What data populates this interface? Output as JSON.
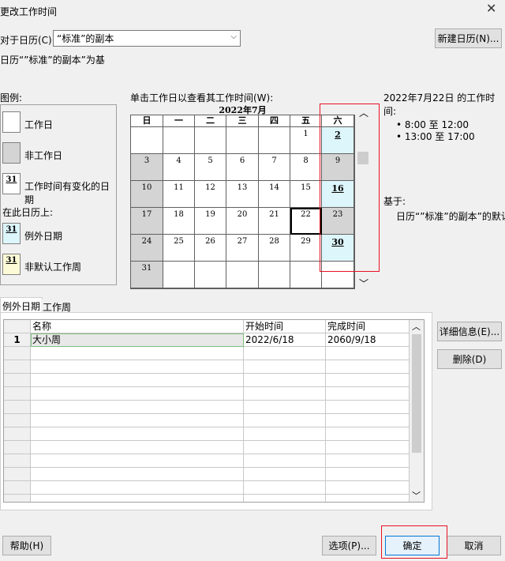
{
  "window": {
    "title": "更改工作时间",
    "close_glyph": "✕"
  },
  "calendar_select": {
    "label": "对于日历(C):",
    "value": "“标准”的副本",
    "base_text": "日历“”标准”的副本”为基"
  },
  "buttons": {
    "new_calendar": "新建日历(N)...",
    "details": "详细信息(E)...",
    "delete": "删除(D)",
    "help": "帮助(H)",
    "options": "选项(P)...",
    "ok": "确定",
    "cancel": "取消"
  },
  "legend": {
    "title": "图例:",
    "working_day": "工作日",
    "nonworking_day": "非工作日",
    "changed_day": "工作时间有变化的日期",
    "on_this_calendar": "在此日历上:",
    "exception_day": "例外日期",
    "nondefault_week": "非默认工作周",
    "swatch_num": "31"
  },
  "calendar_view": {
    "instruction": "单击工作日以查看其工作时间(W):",
    "month_title": "2022年7月",
    "weekdays": [
      "日",
      "一",
      "二",
      "三",
      "四",
      "五",
      "六"
    ],
    "weeks": [
      [
        "",
        "",
        "",
        "",
        "",
        "1",
        "2"
      ],
      [
        "3",
        "4",
        "5",
        "6",
        "7",
        "8",
        "9"
      ],
      [
        "10",
        "11",
        "12",
        "13",
        "14",
        "15",
        "16"
      ],
      [
        "17",
        "18",
        "19",
        "20",
        "21",
        "22",
        "23"
      ],
      [
        "24",
        "25",
        "26",
        "27",
        "28",
        "29",
        "30"
      ],
      [
        "31",
        "",
        "",
        "",
        "",
        "",
        ""
      ]
    ],
    "nonworking_days": [
      "3",
      "9",
      "10",
      "17",
      "23",
      "24",
      "31"
    ],
    "exception_days": [
      "2",
      "16",
      "30"
    ],
    "selected_day": "22",
    "scroll_up": "︿",
    "scroll_down": "﹀"
  },
  "working_times": {
    "title": "2022年7月22日 的工作时间:",
    "slots": [
      "• 8:00 至 12:00",
      "• 13:00 至 17:00"
    ],
    "based_on_label": "基于:",
    "based_on_value": "日历“”标准”的副本”的默认"
  },
  "tabs": [
    {
      "label": "例外日期",
      "active": true
    },
    {
      "label": "工作周",
      "active": false
    }
  ],
  "exceptions_table": {
    "columns": [
      "名称",
      "开始时间",
      "完成时间"
    ],
    "rows": [
      {
        "num": "1",
        "name": "大小周",
        "start": "2022/6/18",
        "finish": "2060/9/18"
      }
    ],
    "scroll_up": "︿",
    "scroll_down": "﹀"
  },
  "colors": {
    "exception_bg": "#ddf6fb",
    "nonworking_bg": "#d4d4d4",
    "nondefault_bg": "#fdfbd7",
    "highlight_red": "#e81123"
  }
}
